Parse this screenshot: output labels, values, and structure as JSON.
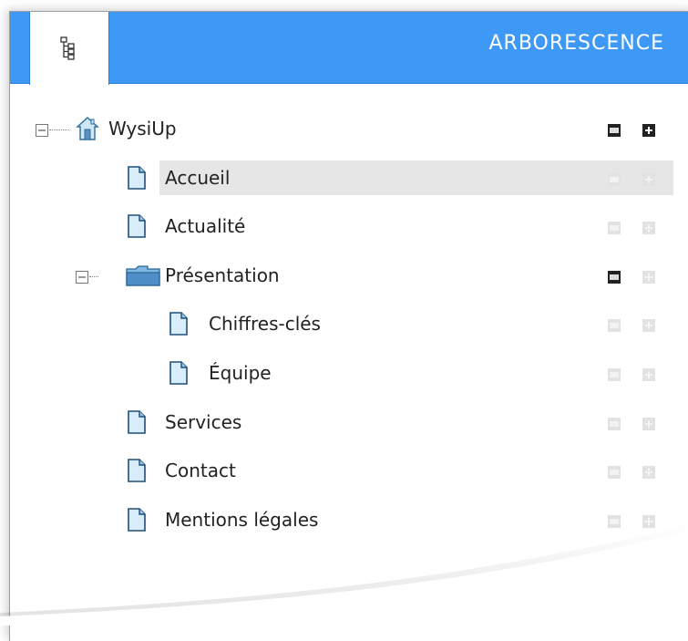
{
  "header": {
    "title": "ARBORESCENCE",
    "tab_icon": "tree-icon",
    "color": "#3d99f5"
  },
  "tree": [
    {
      "label": "WysiUp",
      "icon": "home-icon",
      "level": 0,
      "expanded": true,
      "actions_active": true,
      "add_active": true
    },
    {
      "label": "Accueil",
      "icon": "page-icon",
      "level": 1,
      "selected": true,
      "actions_active": false,
      "add_active": false
    },
    {
      "label": "Actualité",
      "icon": "page-icon",
      "level": 1,
      "actions_active": false,
      "add_active": false
    },
    {
      "label": "Présentation",
      "icon": "folder-icon",
      "level": 1,
      "expanded": true,
      "actions_active": true,
      "add_active": false
    },
    {
      "label": "Chiffres-clés",
      "icon": "page-icon",
      "level": 2,
      "actions_active": false,
      "add_active": false
    },
    {
      "label": "Équipe",
      "icon": "page-icon",
      "level": 2,
      "actions_active": false,
      "add_active": false
    },
    {
      "label": "Services",
      "icon": "page-icon",
      "level": 1,
      "actions_active": false,
      "add_active": false
    },
    {
      "label": "Contact",
      "icon": "page-icon",
      "level": 1,
      "actions_active": false,
      "add_active": false
    },
    {
      "label": "Mentions légales",
      "icon": "page-icon",
      "level": 1,
      "actions_active": false,
      "add_active": false
    }
  ]
}
